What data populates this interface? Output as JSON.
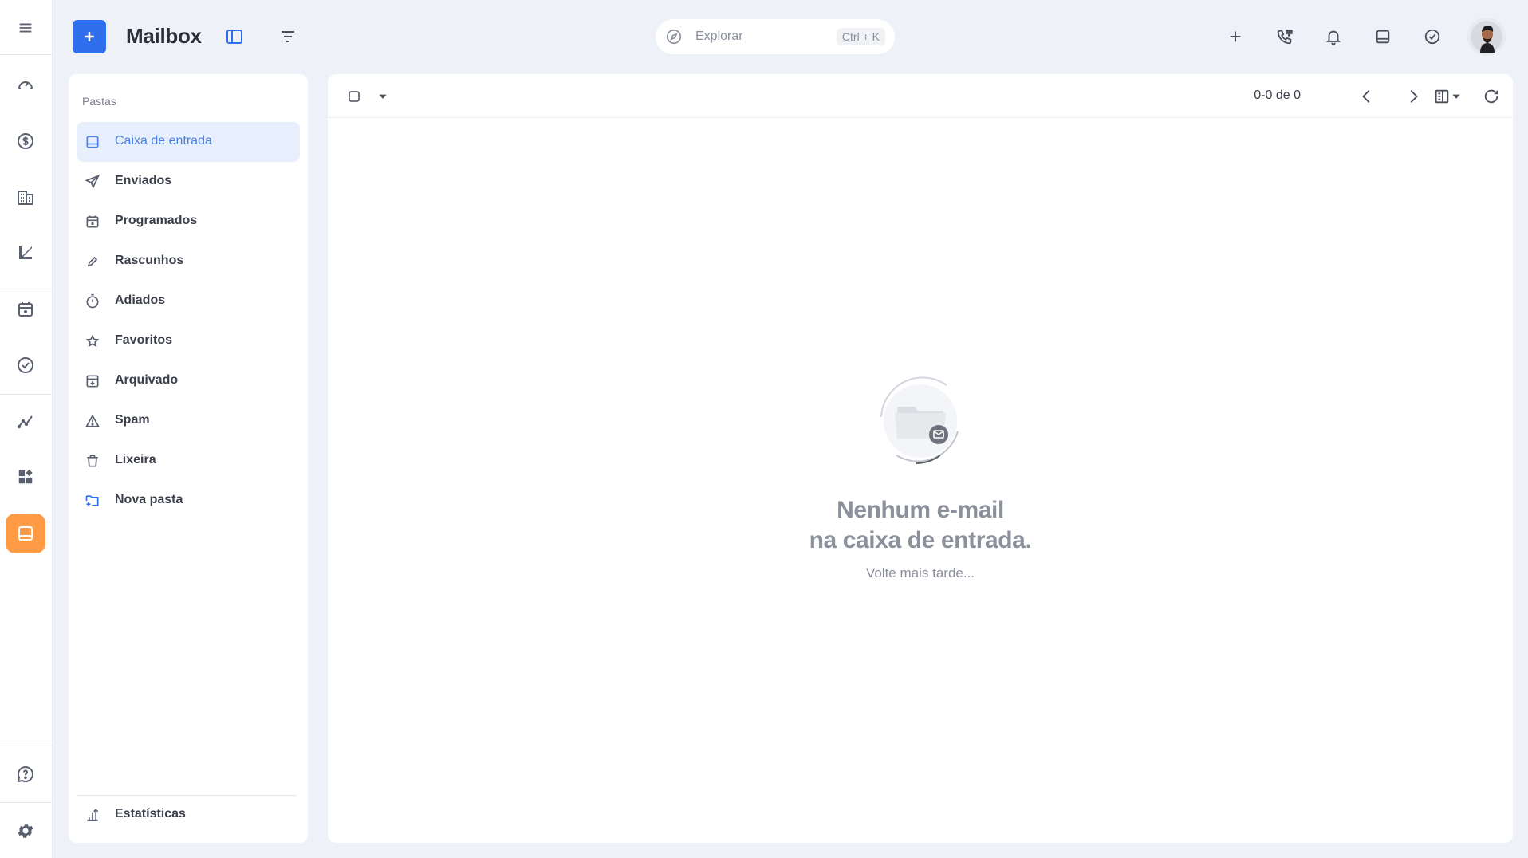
{
  "header": {
    "app_title": "Mailbox",
    "search_placeholder": "Explorar",
    "search_shortcut": "Ctrl + K"
  },
  "rail": {
    "icons": [
      "menu-icon",
      "dashboard-icon",
      "dollar-icon",
      "building-icon",
      "chart-icon",
      "calendar-icon",
      "check-circle-icon",
      "analytics-icon",
      "widgets-icon",
      "inbox-icon",
      "help-icon",
      "gear-icon"
    ],
    "active": "inbox-icon",
    "active_color": "#ff9a45"
  },
  "folders": {
    "header": "Pastas",
    "items": [
      {
        "label": "Caixa de entrada",
        "icon": "inbox-icon",
        "active": true
      },
      {
        "label": "Enviados",
        "icon": "send-icon"
      },
      {
        "label": "Programados",
        "icon": "calendar-icon"
      },
      {
        "label": "Rascunhos",
        "icon": "pencil-icon"
      },
      {
        "label": "Adiados",
        "icon": "timer-icon"
      },
      {
        "label": "Favoritos",
        "icon": "star-icon"
      },
      {
        "label": "Arquivado",
        "icon": "archive-icon"
      },
      {
        "label": "Spam",
        "icon": "warning-icon"
      },
      {
        "label": "Lixeira",
        "icon": "trash-icon"
      },
      {
        "label": "Nova pasta",
        "icon": "new-folder-icon"
      }
    ],
    "footer": {
      "label": "Estatísticas",
      "icon": "stats-icon"
    }
  },
  "mail_toolbar": {
    "page_count": "0-0 de 0"
  },
  "empty_state": {
    "title_line1": "Nenhum e-mail",
    "title_line2": "na caixa de entrada.",
    "subtitle": "Volte mais tarde..."
  },
  "colors": {
    "accent": "#2f6fee",
    "active_folder_bg": "#e7effd",
    "active_folder_text": "#4b82e8"
  }
}
